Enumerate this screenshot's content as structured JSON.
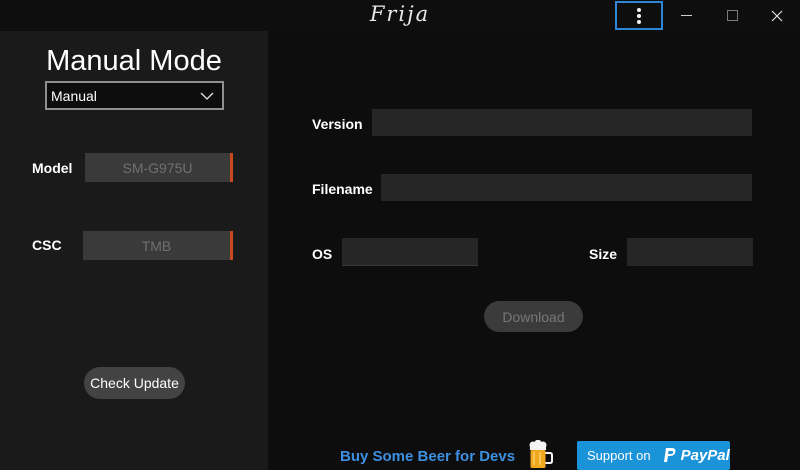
{
  "titlebar": {
    "title": "Frija",
    "menu_icon": "kebab-menu-icon",
    "controls": [
      "minimize-icon",
      "maximize-icon",
      "close-icon"
    ]
  },
  "left": {
    "heading": "Manual Mode",
    "mode_select": {
      "value": "Manual",
      "icon": "chevron-down-icon"
    },
    "model": {
      "label": "Model",
      "placeholder": "SM-G975U"
    },
    "csc": {
      "label": "CSC",
      "placeholder": "TMB"
    },
    "check_update_label": "Check Update"
  },
  "right": {
    "version_label": "Version",
    "filename_label": "Filename",
    "os_label": "OS",
    "size_label": "Size",
    "download_label": "Download"
  },
  "footer": {
    "beer_text": "Buy Some Beer for Devs",
    "paypal_support": "Support on",
    "paypal_brand": "PayPal"
  },
  "colors": {
    "accent_blue": "#2f86d6",
    "input_accent": "#c74a1f",
    "link_blue": "#3d8fe0",
    "paypal_blue": "#1b93d9"
  }
}
